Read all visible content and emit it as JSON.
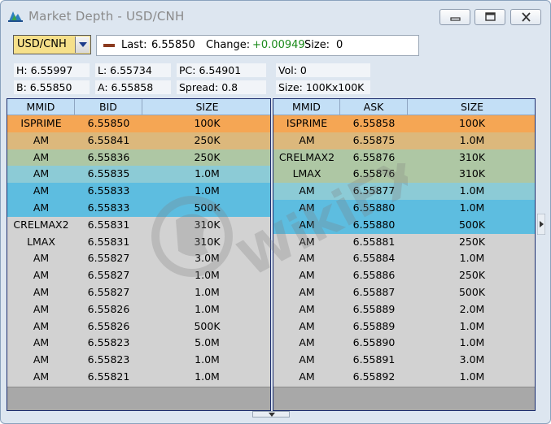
{
  "window": {
    "title": "Market Depth - USD/CNH"
  },
  "icons": {
    "app": "market-depth-icon",
    "minimize": "minimize-icon",
    "maximize": "maximize-icon",
    "close": "close-icon",
    "dropdown": "dropdown-arrow-icon",
    "last_marker": "last-trade-marker-icon"
  },
  "symbol": {
    "value": "USD/CNH"
  },
  "quote": {
    "last_label": "Last:",
    "last_value": "6.55850",
    "change_label": "Change:",
    "change_value": "+0.00949",
    "size_label": "Size:",
    "size_value": "0"
  },
  "stats": {
    "high": "H: 6.55997",
    "low": "L: 6.55734",
    "prev_close": "PC: 6.54901",
    "volume": "Vol: 0",
    "bid": "B: 6.55850",
    "ask": "A: 6.55858",
    "spread": "Spread: 0.8",
    "size": "Size: 100Kx100K"
  },
  "bid_book": {
    "headers": [
      "MMID",
      "BID",
      "SIZE"
    ],
    "rows": [
      {
        "mmid": "ISPRIME",
        "price": "6.55850",
        "size": "100K",
        "color": "#f5a654"
      },
      {
        "mmid": "AM",
        "price": "6.55841",
        "size": "250K",
        "color": "#dcb87c"
      },
      {
        "mmid": "AM",
        "price": "6.55836",
        "size": "250K",
        "color": "#aec7a4"
      },
      {
        "mmid": "AM",
        "price": "6.55835",
        "size": "1.0M",
        "color": "#8ccbd6"
      },
      {
        "mmid": "AM",
        "price": "6.55833",
        "size": "1.0M",
        "color": "#5dbde0"
      },
      {
        "mmid": "AM",
        "price": "6.55833",
        "size": "500K",
        "color": "#5dbde0"
      },
      {
        "mmid": "CRELMAX2",
        "price": "6.55831",
        "size": "310K",
        "color": ""
      },
      {
        "mmid": "LMAX",
        "price": "6.55831",
        "size": "310K",
        "color": ""
      },
      {
        "mmid": "AM",
        "price": "6.55827",
        "size": "3.0M",
        "color": ""
      },
      {
        "mmid": "AM",
        "price": "6.55827",
        "size": "1.0M",
        "color": ""
      },
      {
        "mmid": "AM",
        "price": "6.55827",
        "size": "1.0M",
        "color": ""
      },
      {
        "mmid": "AM",
        "price": "6.55826",
        "size": "1.0M",
        "color": ""
      },
      {
        "mmid": "AM",
        "price": "6.55826",
        "size": "500K",
        "color": ""
      },
      {
        "mmid": "AM",
        "price": "6.55823",
        "size": "5.0M",
        "color": ""
      },
      {
        "mmid": "AM",
        "price": "6.55823",
        "size": "1.0M",
        "color": ""
      },
      {
        "mmid": "AM",
        "price": "6.55821",
        "size": "1.0M",
        "color": ""
      }
    ]
  },
  "ask_book": {
    "headers": [
      "MMID",
      "ASK",
      "SIZE"
    ],
    "rows": [
      {
        "mmid": "ISPRIME",
        "price": "6.55858",
        "size": "100K",
        "color": "#f5a654"
      },
      {
        "mmid": "AM",
        "price": "6.55875",
        "size": "1.0M",
        "color": "#dcb87c"
      },
      {
        "mmid": "CRELMAX2",
        "price": "6.55876",
        "size": "310K",
        "color": "#aec7a4"
      },
      {
        "mmid": "LMAX",
        "price": "6.55876",
        "size": "310K",
        "color": "#aec7a4"
      },
      {
        "mmid": "AM",
        "price": "6.55877",
        "size": "1.0M",
        "color": "#8ccbd6"
      },
      {
        "mmid": "AM",
        "price": "6.55880",
        "size": "1.0M",
        "color": "#5dbde0"
      },
      {
        "mmid": "AM",
        "price": "6.55880",
        "size": "500K",
        "color": "#5dbde0"
      },
      {
        "mmid": "AM",
        "price": "6.55881",
        "size": "250K",
        "color": ""
      },
      {
        "mmid": "AM",
        "price": "6.55884",
        "size": "1.0M",
        "color": ""
      },
      {
        "mmid": "AM",
        "price": "6.55886",
        "size": "250K",
        "color": ""
      },
      {
        "mmid": "AM",
        "price": "6.55887",
        "size": "500K",
        "color": ""
      },
      {
        "mmid": "AM",
        "price": "6.55889",
        "size": "2.0M",
        "color": ""
      },
      {
        "mmid": "AM",
        "price": "6.55889",
        "size": "1.0M",
        "color": ""
      },
      {
        "mmid": "AM",
        "price": "6.55890",
        "size": "1.0M",
        "color": ""
      },
      {
        "mmid": "AM",
        "price": "6.55891",
        "size": "3.0M",
        "color": ""
      },
      {
        "mmid": "AM",
        "price": "6.55892",
        "size": "1.0M",
        "color": ""
      }
    ]
  },
  "watermark": {
    "text": "WikiFX"
  }
}
